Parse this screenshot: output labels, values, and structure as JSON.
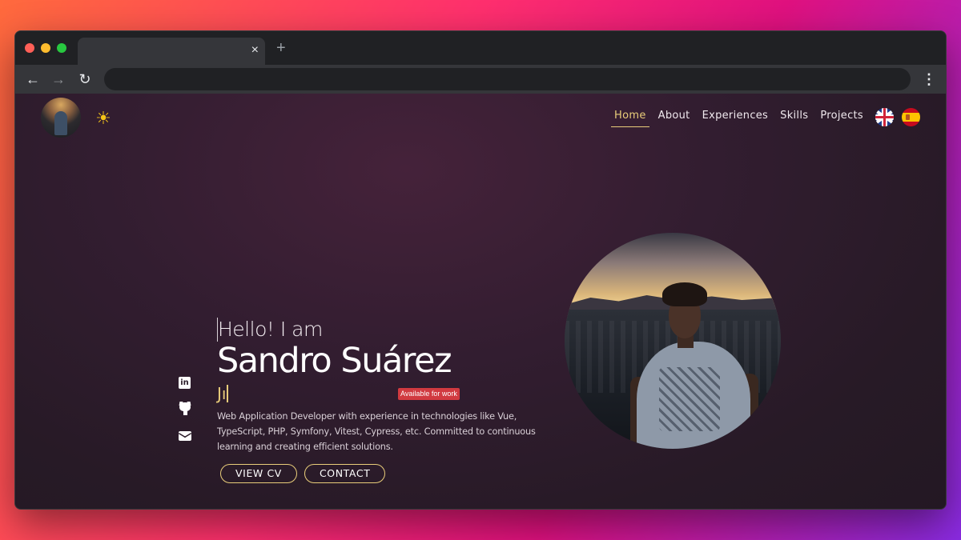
{
  "browser": {
    "tab_close_glyph": "×",
    "new_tab_glyph": "+",
    "back_glyph": "←",
    "forward_glyph": "→",
    "reload_glyph": "↻",
    "menu_glyph": "⋮",
    "address": ""
  },
  "header": {
    "avatar_icon": "profile-photo",
    "theme_toggle_icon": "sun-icon",
    "theme_toggle_glyph": "☀"
  },
  "nav": {
    "items": [
      {
        "label": "Home",
        "active": true
      },
      {
        "label": "About",
        "active": false
      },
      {
        "label": "Experiences",
        "active": false
      },
      {
        "label": "Skills",
        "active": false
      },
      {
        "label": "Projects",
        "active": false
      }
    ],
    "languages": [
      {
        "icon": "uk-flag-icon"
      },
      {
        "icon": "spain-flag-icon"
      }
    ]
  },
  "hero": {
    "greeting": "Hello! I am",
    "name": "Sandro Suárez",
    "typing_text": "Jı",
    "badge": "Available for work",
    "description": "Web Application Developer with experience in technologies like Vue, TypeScript, PHP, Symfony, Vitest, Cypress, etc. Committed to continuous learning and creating efficient solutions.",
    "buttons": {
      "cv": "VIEW CV",
      "contact": "CONTACT"
    }
  },
  "socials": {
    "linkedin_glyph": "in",
    "items": [
      "linkedin-icon",
      "github-icon",
      "mail-icon"
    ]
  },
  "colors": {
    "accent": "#e9cd7a",
    "badge": "#d13a40",
    "page_bg": "#2a1a28"
  }
}
